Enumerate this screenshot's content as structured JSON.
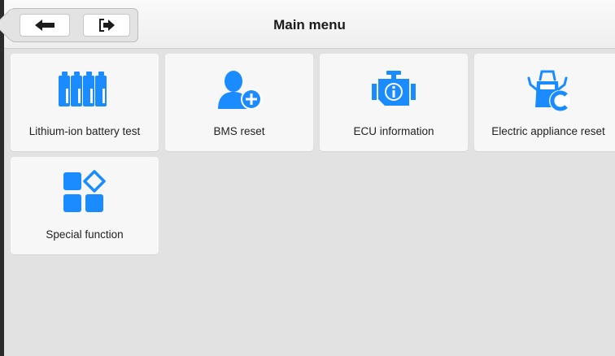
{
  "header": {
    "title": "Main menu",
    "back_icon": "back-arrow-icon",
    "exit_icon": "exit-icon"
  },
  "menu": {
    "items": [
      {
        "label": "Lithium-ion battery test",
        "icon": "battery-icon"
      },
      {
        "label": "BMS reset",
        "icon": "user-add-icon"
      },
      {
        "label": "ECU information",
        "icon": "engine-info-icon"
      },
      {
        "label": "Electric appliance reset",
        "icon": "car-door-reset-icon"
      },
      {
        "label": "Special function",
        "icon": "special-function-icon"
      }
    ]
  },
  "colors": {
    "accent": "#1a8cff",
    "background": "#e2e2e2",
    "tile": "#f7f7f7"
  }
}
